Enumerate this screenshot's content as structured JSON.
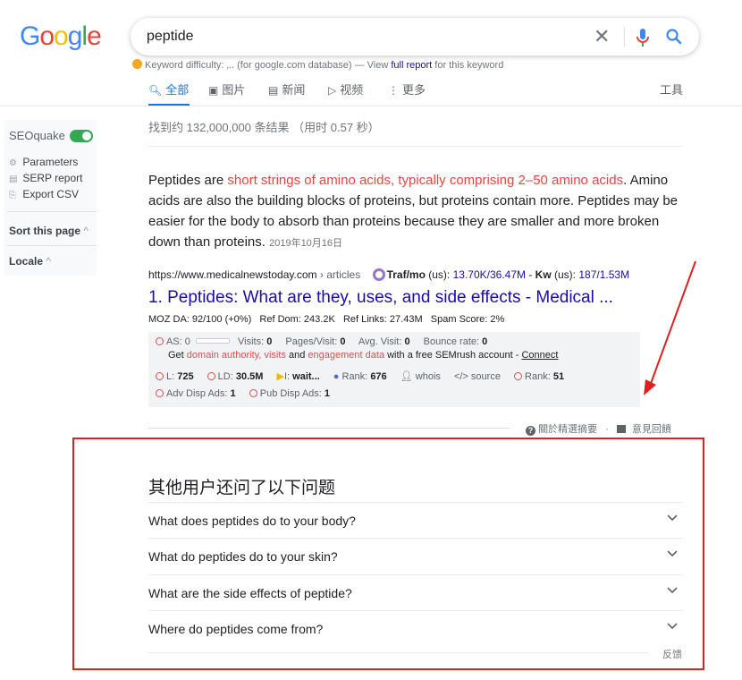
{
  "logo": {
    "letters": [
      "G",
      "o",
      "o",
      "g",
      "l",
      "e"
    ],
    "colors": [
      "#4285f4",
      "#ea4335",
      "#fbbc05",
      "#4285f4",
      "#34a853",
      "#ea4335"
    ]
  },
  "search": {
    "query": "peptide",
    "clear": "✕"
  },
  "keyword_difficulty": {
    "prefix": "Keyword difficulty:",
    "value": "‚..",
    "middle": "(for google.com database) — View",
    "link": "full report",
    "suffix": "for this keyword"
  },
  "tabs": [
    {
      "label": "全部",
      "icon": "search-icon",
      "glyph": "🔍︎"
    },
    {
      "label": "图片",
      "icon": "image-icon",
      "glyph": "▣"
    },
    {
      "label": "新闻",
      "icon": "news-icon",
      "glyph": "▤"
    },
    {
      "label": "视频",
      "icon": "video-icon",
      "glyph": "▷"
    },
    {
      "label": "更多",
      "icon": "more-icon",
      "glyph": "⋮"
    }
  ],
  "tools": "工具",
  "sidebar": {
    "title": "SEOquake",
    "items": [
      "Parameters",
      "SERP report",
      "Export CSV"
    ],
    "sort": "Sort this page",
    "locale": "Locale"
  },
  "stats": "找到约 132,000,000 条结果 （用时 0.57 秒）",
  "snippet": {
    "before": "Peptides are ",
    "highlight": "short strings of amino acids, typically comprising 2–50 amino acids",
    "after": ". Amino acids are also the building blocks of proteins, but proteins contain more. Peptides may be easier for the body to absorb than proteins because they are smaller and more broken down than proteins.",
    "date": "2019年10月16日"
  },
  "result": {
    "url": "https://www.medicalnewstoday.com",
    "crumb": "› articles",
    "traf_label": "Traf/mo",
    "traf_us": "(us):",
    "traf_value": "13.70K/36.47M",
    "kw_label": "Kw",
    "kw_us": "(us):",
    "kw_value": "187/1.53M",
    "title": "1. Peptides: What are they, uses, and side effects - Medical ...",
    "moz": "MOZ DA: 92/100 (+0%)   Ref Dom: 243.2K   Ref Links: 27.43M   Spam Score: 2%"
  },
  "seoquake": {
    "as_label": "AS:",
    "as_value": "0",
    "visits_label": "Visits:",
    "visits_value": "0",
    "ppv_label": "Pages/Visit:",
    "ppv_value": "0",
    "avg_label": "Avg. Visit:",
    "avg_value": "0",
    "bounce_label": "Bounce rate:",
    "bounce_value": "0",
    "get_text": "Get",
    "da_link": "domain authority,",
    "visits_link": "visits",
    "and": "and",
    "eng_link": "engagement data",
    "free_text": "with a free SEMrush account -",
    "connect": "Connect",
    "l_label": "L:",
    "l_value": "725",
    "ld_label": "LD:",
    "ld_value": "30.5M",
    "i_label": "I:",
    "i_value": "wait...",
    "rank1_label": "Rank:",
    "rank1_value": "676",
    "whois": "whois",
    "source": "source",
    "rank2_label": "Rank:",
    "rank2_value": "51",
    "adv_label": "Adv Disp Ads:",
    "adv_value": "1",
    "pub_label": "Pub Disp Ads:",
    "pub_value": "1"
  },
  "snippet_footer": {
    "about": "關於精選摘要",
    "dot": "·",
    "feedback": "意見回饋"
  },
  "paa": {
    "title": "其他用户还问了以下问题",
    "questions": [
      "What does peptides do to your body?",
      "What do peptides do to your skin?",
      "What are the side effects of peptide?",
      "Where do peptides come from?"
    ],
    "feedback": "反馈"
  }
}
